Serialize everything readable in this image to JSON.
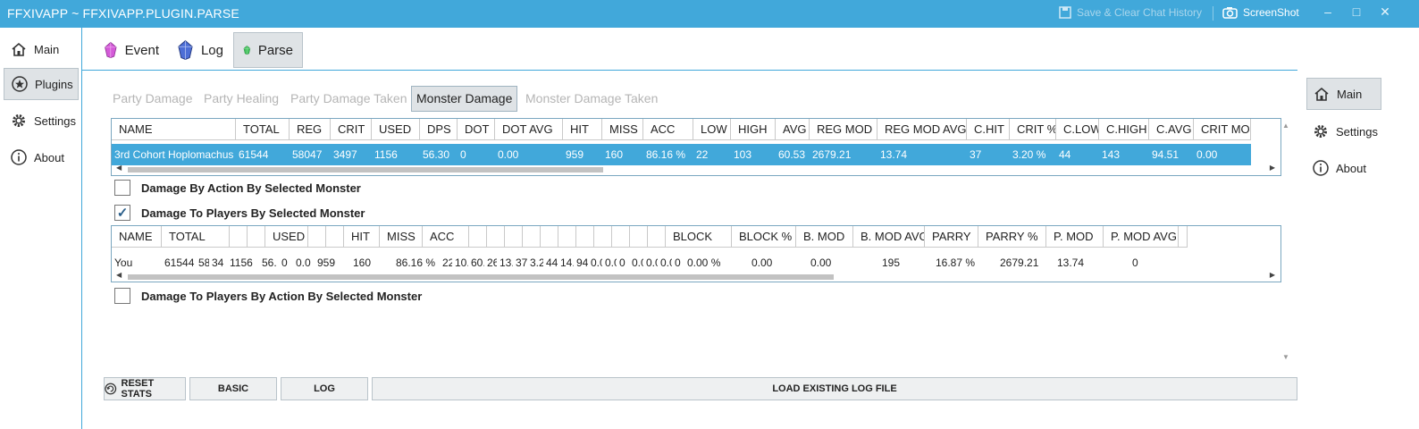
{
  "window": {
    "title": "FFXIVAPP ~ FFXIVAPP.PLUGIN.PARSE",
    "save_clear": "Save & Clear Chat History",
    "screenshot": "ScreenShot"
  },
  "left_nav": [
    {
      "label": "Main",
      "icon": "home-icon",
      "active": false
    },
    {
      "label": "Plugins",
      "icon": "star-icon",
      "active": true
    },
    {
      "label": "Settings",
      "icon": "gear-icon",
      "active": false
    },
    {
      "label": "About",
      "icon": "info-icon",
      "active": false
    }
  ],
  "right_nav": [
    {
      "label": "Main",
      "icon": "home-icon",
      "active": true
    },
    {
      "label": "Settings",
      "icon": "gear-icon",
      "active": false
    },
    {
      "label": "About",
      "icon": "info-icon",
      "active": false
    }
  ],
  "plugin_tabs": [
    {
      "label": "Event",
      "icon": "pink-crystal-icon",
      "color": "#d45ad8"
    },
    {
      "label": "Log",
      "icon": "blue-crystal-icon",
      "color": "#4d6ed6"
    },
    {
      "label": "Parse",
      "icon": "green-crystal-icon",
      "color": "#44c25e"
    }
  ],
  "sub_tabs": [
    "Party Damage",
    "Party Healing",
    "Party Damage Taken",
    "Monster Damage",
    "Monster Damage Taken"
  ],
  "monster_grid": {
    "headers": [
      "NAME",
      "TOTAL",
      "REG",
      "CRIT",
      "USED",
      "DPS",
      "DOT",
      "DOT AVG",
      "HIT",
      "MISS",
      "ACC",
      "LOW",
      "HIGH",
      "AVG",
      "REG MOD",
      "REG MOD AVG",
      "C.HIT",
      "CRIT %",
      "C.LOW",
      "C.HIGH",
      "C.AVG",
      "CRIT MOD"
    ],
    "row": [
      "3rd Cohort Hoplomachus",
      "61544",
      "58047",
      "3497",
      "1156",
      "56.30",
      "0",
      "0.00",
      "959",
      "160",
      "86.16 %",
      "22",
      "103",
      "60.53",
      "2679.21",
      "13.74",
      "37",
      "3.20 %",
      "44",
      "143",
      "94.51",
      "0.00"
    ]
  },
  "checks": {
    "by_action": "Damage By Action By Selected Monster",
    "to_players": "Damage To Players By Selected Monster",
    "to_players_by_action": "Damage To Players By Action By Selected Monster"
  },
  "players_grid": {
    "headers": [
      "NAME",
      "TOTAL",
      "",
      "",
      "USED",
      "",
      "",
      "HIT",
      "MISS",
      "ACC",
      "",
      "",
      "",
      "",
      "",
      "",
      "",
      "",
      "",
      "",
      "",
      "BLOCK",
      "BLOCK %",
      "B. MOD",
      "B. MOD AVG",
      "PARRY",
      "PARRY %",
      "P. MOD",
      "P. MOD AVG",
      ""
    ],
    "row": [
      "You",
      "61544",
      "58",
      "34",
      "1156",
      "56.",
      "0",
      "0.0",
      "959",
      "160",
      "86.16 %",
      "22",
      "10.",
      "60.",
      "26",
      "13.",
      "37",
      "3.2",
      "44",
      "14.",
      "94.",
      "0.0",
      "0.0",
      "0",
      "0.0",
      "0.0",
      "0.0",
      "0",
      "0.00 %",
      "0.00",
      "0.00",
      "195",
      "16.87 %",
      "2679.21",
      "13.74",
      "0"
    ]
  },
  "buttons": {
    "reset": "RESET STATS",
    "basic": "BASIC",
    "log": "LOG",
    "load": "LOAD EXISTING LOG FILE"
  }
}
